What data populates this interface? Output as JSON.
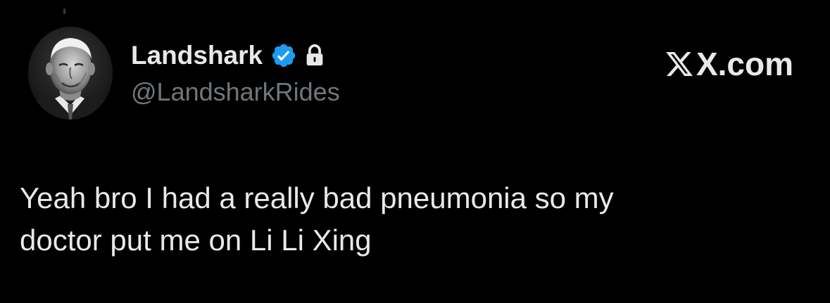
{
  "tweet": {
    "display_name": "Landshark",
    "handle": "@LandsharkRides",
    "brand": "X.com",
    "text": "Yeah bro I had a really bad pneumonia so my\ndoctor put me on Li Li Xing"
  },
  "icons": {
    "verified": "verified-badge-icon",
    "protected": "lock-icon",
    "brand_logo": "x-logo-icon"
  },
  "colors": {
    "background": "#000000",
    "primary_text": "#e7e9ea",
    "secondary_text": "#71767b",
    "verified_blue": "#1d9bf0"
  }
}
